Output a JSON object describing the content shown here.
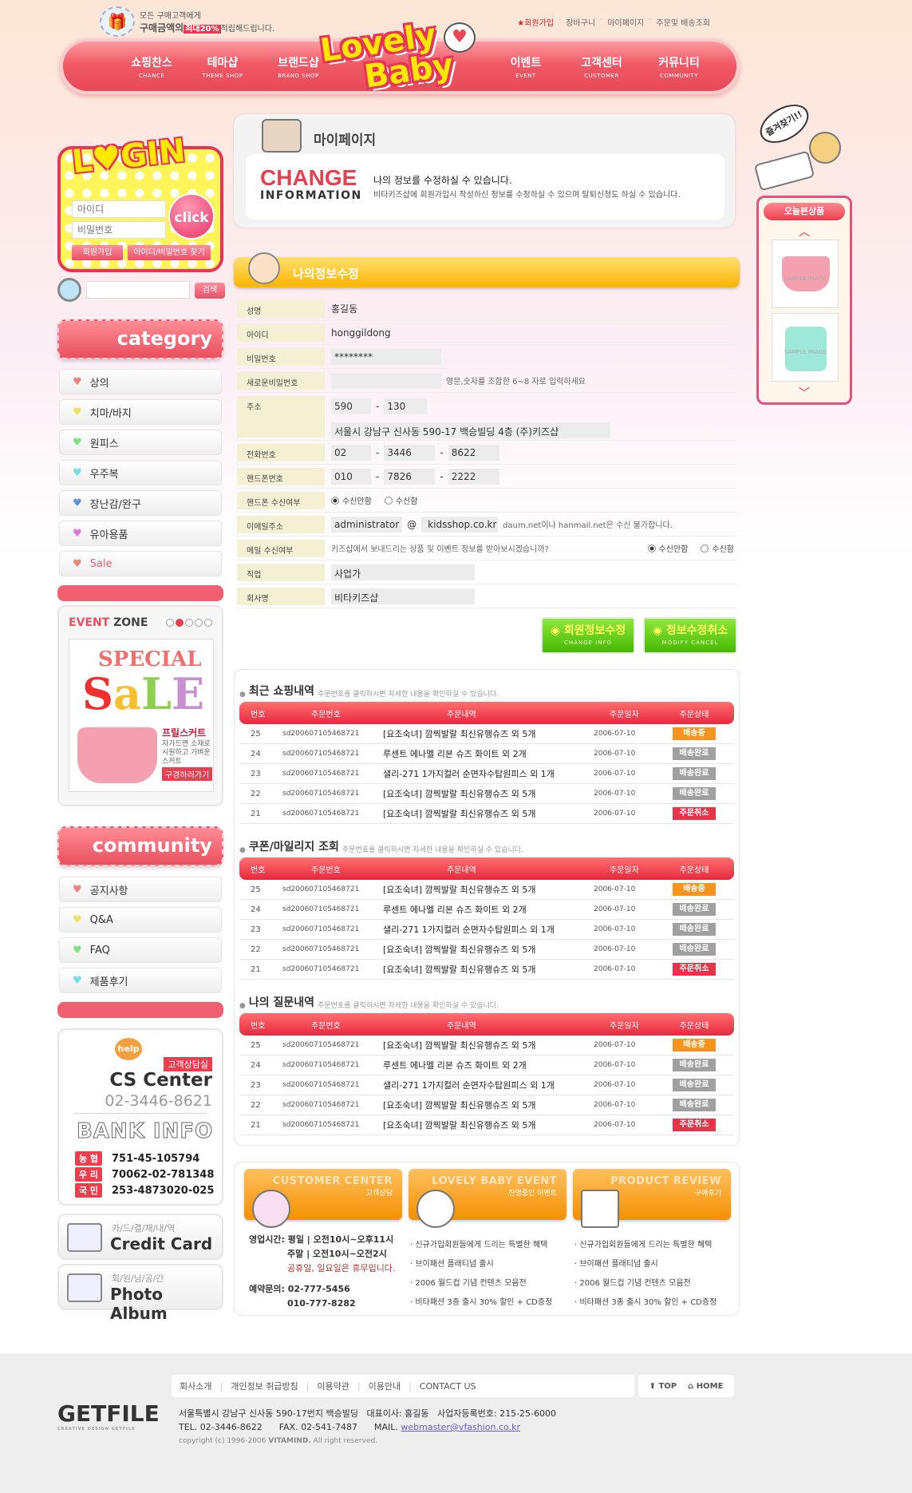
{
  "top": {
    "promo_line1": "모든 구매고객에게",
    "promo_line2a": "구매금액의",
    "promo_pct": "최대20%",
    "promo_line2b": "적립해드립니다.",
    "links": [
      "회원가입",
      "장바구니",
      "마이페이지",
      "주문및 배송조회"
    ]
  },
  "nav": {
    "left": [
      {
        "ko": "쇼핑찬스",
        "en": "CHANCE"
      },
      {
        "ko": "테마샵",
        "en": "THEME SHOP"
      },
      {
        "ko": "브랜드샵",
        "en": "BRAND SHOP"
      }
    ],
    "right": [
      {
        "ko": "이벤트",
        "en": "EVENT"
      },
      {
        "ko": "고객센터",
        "en": "CUSTOMER"
      },
      {
        "ko": "커뮤니티",
        "en": "COMMUNITY"
      }
    ],
    "logo_l1": "Lovely",
    "logo_l2": "Baby"
  },
  "login": {
    "title": "L♥GIN",
    "id_placeholder": "아이디",
    "pw_placeholder": "비밀번호",
    "click": "click",
    "join": "회원가입",
    "find": "아이디/비밀번호 찾기"
  },
  "search": {
    "button": "검색"
  },
  "category": {
    "title": "category",
    "items": [
      {
        "label": "상의",
        "color": "#f08080"
      },
      {
        "label": "치마/바지",
        "color": "#f0e060"
      },
      {
        "label": "원피스",
        "color": "#80e080"
      },
      {
        "label": "우주복",
        "color": "#70e0e0"
      },
      {
        "label": "장난감/완구",
        "color": "#6090e0"
      },
      {
        "label": "유아용품",
        "color": "#e070e0"
      },
      {
        "label": "Sale",
        "color": "#f08070"
      }
    ]
  },
  "event": {
    "title_a": "EVENT",
    "title_b": "ZONE",
    "special": "SPECIAL",
    "sale_letters": [
      "S",
      "a",
      "L",
      "E"
    ],
    "product": "프릴스커트",
    "desc": "자가드면 소재로 시원하고 가벼운 스커트",
    "go": "구경하러가기",
    "active_slide": 2,
    "slides": 5
  },
  "community": {
    "title": "community",
    "items": [
      {
        "label": "공지사항",
        "color": "#f08080"
      },
      {
        "label": "Q&A",
        "color": "#f0e060"
      },
      {
        "label": "FAQ",
        "color": "#80e080"
      },
      {
        "label": "제품후기",
        "color": "#70e0e0"
      }
    ]
  },
  "cs": {
    "help": "help",
    "tag": "고객상담실",
    "title": "CS Center",
    "phone": "02-3446-8621",
    "bank_title": "BANK INFO",
    "banks": [
      {
        "name": "농 협",
        "acct": "751-45-105794"
      },
      {
        "name": "우 리",
        "acct": "70062-02-781348"
      },
      {
        "name": "국 민",
        "acct": "253-4873020-025"
      }
    ]
  },
  "credit": {
    "sub": "카/드/결/재/내/역",
    "title": "Credit Card"
  },
  "photo": {
    "sub": "회/원/님/공/간",
    "title": "Photo Album"
  },
  "mypage": {
    "title": "마이페이지",
    "change": "CHANGE",
    "information": "INFORMATION",
    "line1": "나의 정보를 수정하실 수 있습니다.",
    "line2": "비타키즈샵에 회원가입시 작성하신 정보를 수정하실 수 있으며 탈퇴신청도 하실 수 있습니다."
  },
  "form": {
    "title": "나의정보수정",
    "name_l": "성명",
    "name": "홍길동",
    "id_l": "아이디",
    "id": "honggildong",
    "pw_l": "비밀번호",
    "pw": "********",
    "newpw_l": "새로운비밀번호",
    "newpw_hint": "영문,숫자를 조합한 6~8 자로 입력하세요",
    "addr_l": "주소",
    "zip1": "590",
    "zip2": "130",
    "addr": "서울시 강남구 신사동 590-17 백승빌딩 4층 (주)키즈샵",
    "tel_l": "전화번호",
    "tel": [
      "02",
      "3446",
      "8622"
    ],
    "hp_l": "핸드폰번호",
    "hp": [
      "010",
      "7826",
      "2222"
    ],
    "sms_l": "핸드폰 수신여부",
    "opt_no": "수신안함",
    "opt_yes": "수신함",
    "email_l": "이메일주소",
    "email_user": "administrator",
    "at": "@",
    "email_domain": "kidsshop.co.kr",
    "email_hint": "daum.net이나 hanmail.net은 수신 불가합니다.",
    "mail_l": "메일 수신여부",
    "mail_q": "키즈샵에서 보내드리는 상품 및 이벤트 정보를 받아보시겠습니까?",
    "job_l": "직업",
    "job": "사업가",
    "company_l": "회사명",
    "company": "비타키즈샵",
    "sms_selected": "수신안함",
    "mail_selected": "수신안함"
  },
  "buttons": {
    "save_ko": "회원정보수정",
    "save_en": "CHANGE INFO",
    "cancel_ko": "정보수정취소",
    "cancel_en": "MODIFY CANCEL"
  },
  "tables": {
    "headers": [
      "번호",
      "주문번호",
      "주문내역",
      "주문일자",
      "주문상태"
    ],
    "hint": "주문번호를 클릭하시면 자세한 내용을 확인하실 수 있습니다.",
    "status_colors": {
      "배송중": "#f7941d",
      "배송완료": "#a0a0a0",
      "주문취소": "#e8344a"
    },
    "sections": [
      {
        "title": "최근 쇼핑내역"
      },
      {
        "title": "쿠폰/마일리지 조회"
      },
      {
        "title": "나의 질문내역"
      }
    ],
    "rows": [
      [
        "25",
        "sd200607105468721",
        "[요조숙녀] 깜찍발랄 최신유행슈즈 외 5개",
        "2006-07-10",
        "배송중"
      ],
      [
        "24",
        "sd200607105468721",
        "루센트 에나멜 리본 슈즈 화이트 외 2개",
        "2006-07-10",
        "배송완료"
      ],
      [
        "23",
        "sd200607105468721",
        "샐리-271 1가지컬러 순면자수탑원피스 외 1개",
        "2006-07-10",
        "배송완료"
      ],
      [
        "22",
        "sd200607105468721",
        "[요조숙녀] 깜찍발랄 최신유행슈즈 외 5개",
        "2006-07-10",
        "배송완료"
      ],
      [
        "21",
        "sd200607105468721",
        "[요조숙녀] 깜찍발랄 최신유행슈즈 외 5개",
        "2006-07-10",
        "주문취소"
      ]
    ]
  },
  "panels": {
    "cc_en": "CUSTOMER CENTER",
    "cc_ko": "고객상담",
    "ev_en": "LOVELY BABY EVENT",
    "ev_ko": "진행중인 이벤트",
    "rv_en": "PRODUCT REVIEW",
    "rv_ko": "구매후기",
    "hours_l": "영업시간:",
    "weekday": "평일 | 오전10시~오후11시",
    "weekend": "주말 | 오전10시~오전2시",
    "holiday": "공휴일, 일요일은 휴무입니다.",
    "reserve_l": "예약문의:",
    "phone1": "02-777-5456",
    "phone2": "010-777-8282",
    "list": [
      "신규가입회원들에게 드리는 특별한 혜택",
      "브이패션 플래티넘 출시",
      "2006 월드컵 기념 컨텐츠 모음전",
      "비타패션 3종 출시 30% 할인 + CD증정"
    ]
  },
  "today": {
    "bubble": "즐겨찾기!!",
    "title": "오늘본상품",
    "sample": "SAMPLE IMAGE"
  },
  "footer": {
    "links": [
      "회사소개",
      "개인정보 취급방침",
      "이용약관",
      "이용안내",
      "CONTACT US"
    ],
    "top": "TOP",
    "home": "HOME",
    "logo": "GETFILE",
    "logo_sub": "CREATIVE DESIGN GETFILE",
    "addr": "서울특별시 강남구 신사동 590-17번지 백승빌딩",
    "ceo": "대표이사: 홍길동",
    "biz": "사업자등록번호: 215-25-6000",
    "tel": "TEL. 02-3446-8622",
    "fax": "FAX. 02-541-7487",
    "mail_l": "MAIL.",
    "mail": "webmaster@vfashion.co.kr",
    "copy_a": "copyright (c) 1996-2006",
    "copy_b": "VITAMIND.",
    "copy_c": "All right reserved."
  }
}
